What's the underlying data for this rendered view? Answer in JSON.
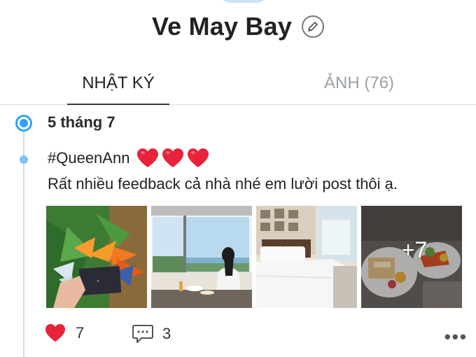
{
  "profile": {
    "name": "Ve May Bay"
  },
  "tabs": [
    {
      "label": "NHẬT KÝ"
    },
    {
      "label": "ẢNH (76)"
    }
  ],
  "post": {
    "date": "5 tháng 7",
    "hashtag": "#QueenAnn",
    "text": "Rất nhiều feedback cả nhà nhé em lười post thôi ạ.",
    "more_photos": "+7",
    "likes": "7",
    "comments": "3",
    "more_label": "•••"
  },
  "colors": {
    "accent": "#34a2f0",
    "heart": "#e8223a"
  },
  "icons": {
    "edit": "pencil-icon",
    "like": "heart-icon",
    "comment": "comment-bubble-icon",
    "more": "more-dots-icon"
  }
}
